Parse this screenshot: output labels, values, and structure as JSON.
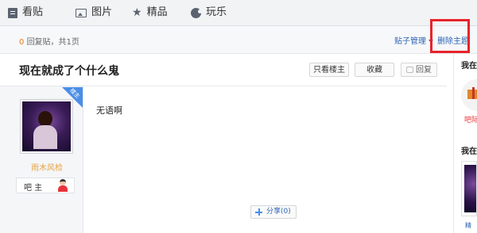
{
  "nav": {
    "items": [
      {
        "label": "看贴",
        "icon": "document-icon"
      },
      {
        "label": "图片",
        "icon": "picture-icon"
      },
      {
        "label": "精品",
        "icon": "star-icon"
      },
      {
        "label": "玩乐",
        "icon": "game-icon"
      }
    ]
  },
  "subbar": {
    "reply_count": "0",
    "reply_suffix": "回复贴，共1页",
    "manage_label": "贴子管理",
    "delete_label": "删除主题"
  },
  "thread": {
    "title": "现在就成了个什么鬼",
    "buttons": {
      "only_op": "只看楼主",
      "favorite": "收藏",
      "reply": "回复"
    }
  },
  "post": {
    "badge": "楼主",
    "username": "雨木风检",
    "role": "吧 主",
    "content": "无语啊",
    "share_label": "分享(0)"
  },
  "sidebar": {
    "heading1": "我在",
    "gift_label": "吧际",
    "heading2": "我在",
    "thumb_label": "精"
  },
  "colors": {
    "link": "#2d64b3",
    "highlight": "#e8232a",
    "reply_count": "#e67e22",
    "username": "#e6a23c"
  }
}
